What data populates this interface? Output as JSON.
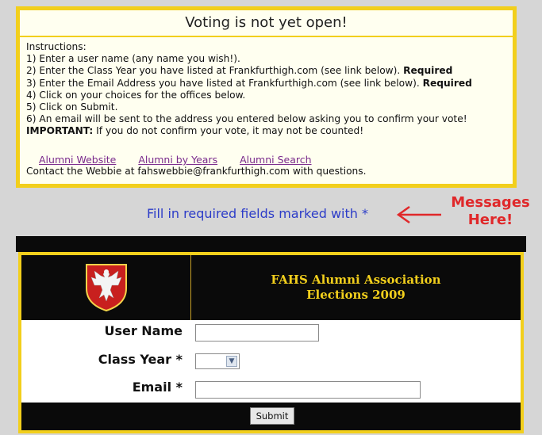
{
  "top": {
    "title": "Voting is not yet open!",
    "instructions": {
      "heading": "Instructions:",
      "line1": "1) Enter a user name (any name you wish!).",
      "line2_text": "2) Enter the Class Year you have listed at Frankfurthigh.com (see link below). ",
      "line2_req": "Required",
      "line3_text": "3) Enter the Email Address you have listed at Frankfurthigh.com (see link below). ",
      "line3_req": "Required",
      "line4": "4) Click on your choices for the offices below.",
      "line5": "5) Click on Submit.",
      "line6": "6) An email will be sent to the address you entered below asking you to confirm your vote!",
      "important_label": "IMPORTANT:",
      "important_text": " If you do not confirm your vote, it may not be counted!"
    },
    "links": [
      "Alumni Website",
      "Alumni by Years",
      "Alumni Search"
    ],
    "contact": "Contact the Webbie at fahswebbie@frankfurthigh.com with questions."
  },
  "message": {
    "fill_text": "Fill in required fields marked with *",
    "annotation_line1": "Messages",
    "annotation_line2": "Here!"
  },
  "form": {
    "header_line1": "FAHS Alumni Association",
    "header_line2": "Elections 2009",
    "user_name_label": "User Name",
    "class_year_label": "Class Year *",
    "email_label": "Email *",
    "user_name_value": "",
    "class_year_value": "",
    "email_value": "",
    "submit_label": "Submit"
  },
  "colors": {
    "border_gold": "#f2cf1c",
    "header_text": "#f2cf1c",
    "message_blue": "#2c3cc8",
    "annotation_red": "#e0282a",
    "link_purple": "#7a2a8c"
  },
  "icons": {
    "crest": "eagle-crest-icon",
    "arrow": "left-arrow-icon",
    "dropdown": "chevron-down-icon"
  }
}
